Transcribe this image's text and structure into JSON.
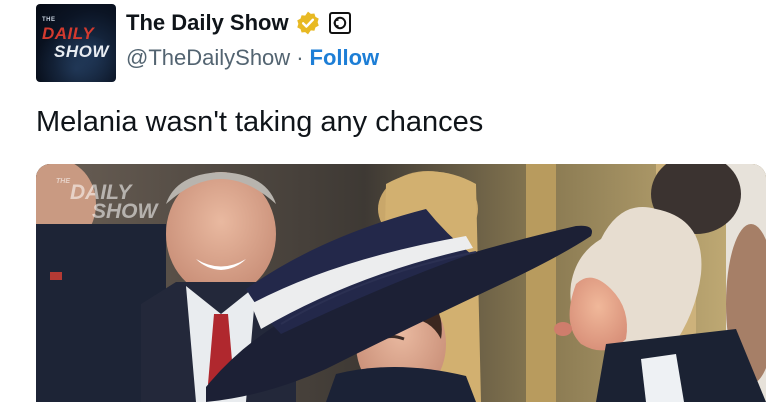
{
  "author": {
    "display_name": "The Daily Show",
    "handle": "@TheDailyShow",
    "separator": "·",
    "follow_label": "Follow",
    "verified_badge_color": "#e8b923",
    "avatar": {
      "small_text": "THE",
      "word1": "DAILY",
      "word2": "SHOW",
      "accent_color": "#d33a2f",
      "bg_color": "#0b1424"
    },
    "network_badge_icon": "comedy-central-icon"
  },
  "tweet": {
    "text": "Melania wasn't taking any chances"
  },
  "media": {
    "watermark": {
      "small": "THE",
      "line1": "DAILY",
      "line2": "SHOW"
    }
  }
}
